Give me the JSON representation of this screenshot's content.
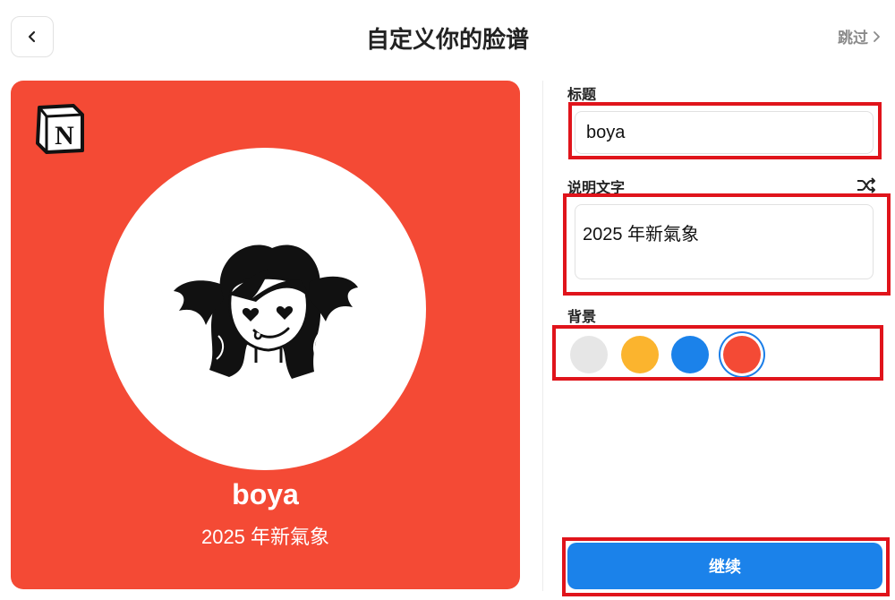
{
  "header": {
    "title": "自定义你的脸谱",
    "skip_label": "跳过"
  },
  "preview": {
    "title": "boya",
    "subtitle": "2025 年新氣象",
    "background_color": "#f44a35",
    "logo_letter": "N"
  },
  "form": {
    "title_label": "标题",
    "title_value": "boya",
    "caption_label": "说明文字",
    "caption_value": "2025 年新氣象",
    "background_label": "背景",
    "swatches": [
      {
        "color": "#e6e6e6",
        "selected": false
      },
      {
        "color": "#fbb42e",
        "selected": false
      },
      {
        "color": "#1b82ea",
        "selected": false
      },
      {
        "color": "#f44a35",
        "selected": true
      }
    ],
    "continue_label": "继续"
  },
  "colors": {
    "accent": "#1b82ea",
    "highlight": "#e0141b"
  }
}
